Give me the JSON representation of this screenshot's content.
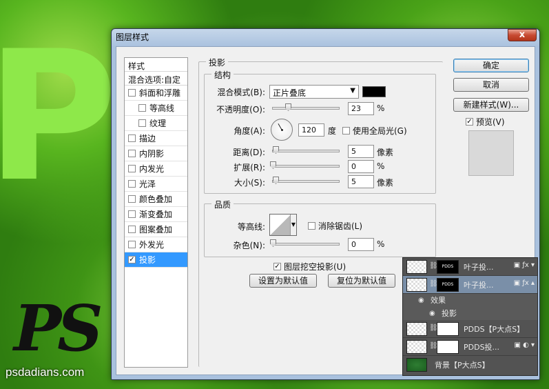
{
  "background": {
    "letter": "P",
    "logo_text": "PS",
    "site_url": "psdadians.com"
  },
  "dialog": {
    "title": "图层样式",
    "close_label": "x"
  },
  "style_list": {
    "header": "样式",
    "blend_options": "混合选项:自定",
    "items": [
      {
        "label": "斜面和浮雕",
        "checked": false,
        "sub": false
      },
      {
        "label": "等高线",
        "checked": false,
        "sub": true
      },
      {
        "label": "纹理",
        "checked": false,
        "sub": true
      },
      {
        "label": "描边",
        "checked": false,
        "sub": false
      },
      {
        "label": "内阴影",
        "checked": false,
        "sub": false
      },
      {
        "label": "内发光",
        "checked": false,
        "sub": false
      },
      {
        "label": "光泽",
        "checked": false,
        "sub": false
      },
      {
        "label": "颜色叠加",
        "checked": false,
        "sub": false
      },
      {
        "label": "渐变叠加",
        "checked": false,
        "sub": false
      },
      {
        "label": "图案叠加",
        "checked": false,
        "sub": false
      },
      {
        "label": "外发光",
        "checked": false,
        "sub": false
      },
      {
        "label": "投影",
        "checked": true,
        "sub": false,
        "active": true
      }
    ]
  },
  "drop_shadow": {
    "section_title": "投影",
    "structure": {
      "title": "结构",
      "blend_mode_label": "混合模式(B):",
      "blend_mode_value": "正片叠底",
      "shadow_color": "#000000",
      "opacity_label": "不透明度(O):",
      "opacity_value": "23",
      "opacity_unit": "%",
      "angle_label": "角度(A):",
      "angle_value": "120",
      "angle_unit": "度",
      "global_light_label": "使用全局光(G)",
      "global_light_checked": false,
      "distance_label": "距离(D):",
      "distance_value": "5",
      "distance_unit": "像素",
      "spread_label": "扩展(R):",
      "spread_value": "0",
      "spread_unit": "%",
      "size_label": "大小(S):",
      "size_value": "5",
      "size_unit": "像素"
    },
    "quality": {
      "title": "品质",
      "contour_label": "等高线:",
      "anti_alias_label": "消除锯齿(L)",
      "anti_alias_checked": false,
      "noise_label": "杂色(N):",
      "noise_value": "0",
      "noise_unit": "%"
    },
    "knockout_label": "图层挖空投影(U)",
    "knockout_checked": true,
    "make_default_label": "设置为默认值",
    "reset_default_label": "复位为默认值"
  },
  "buttons": {
    "ok": "确定",
    "cancel": "取消",
    "new_style": "新建样式(W)...",
    "preview_label": "预览(V)",
    "preview_checked": true
  },
  "layers": [
    {
      "name": "叶子投...",
      "mask_text": "PDDS",
      "selected": false,
      "fx": true
    },
    {
      "name": "叶子投...",
      "mask_text": "PDDS",
      "selected": true,
      "fx": true
    },
    {
      "effects_label": "效果",
      "effect_item": "投影"
    },
    {
      "name": "PDDS【P大点S】",
      "mask_text": "",
      "selected": false,
      "fx": false
    },
    {
      "name": "PDDS投...",
      "mask_text": "",
      "selected": false,
      "fx": false
    },
    {
      "name": "背景【P大点S】",
      "selected": false,
      "fx": false,
      "background": true
    }
  ]
}
